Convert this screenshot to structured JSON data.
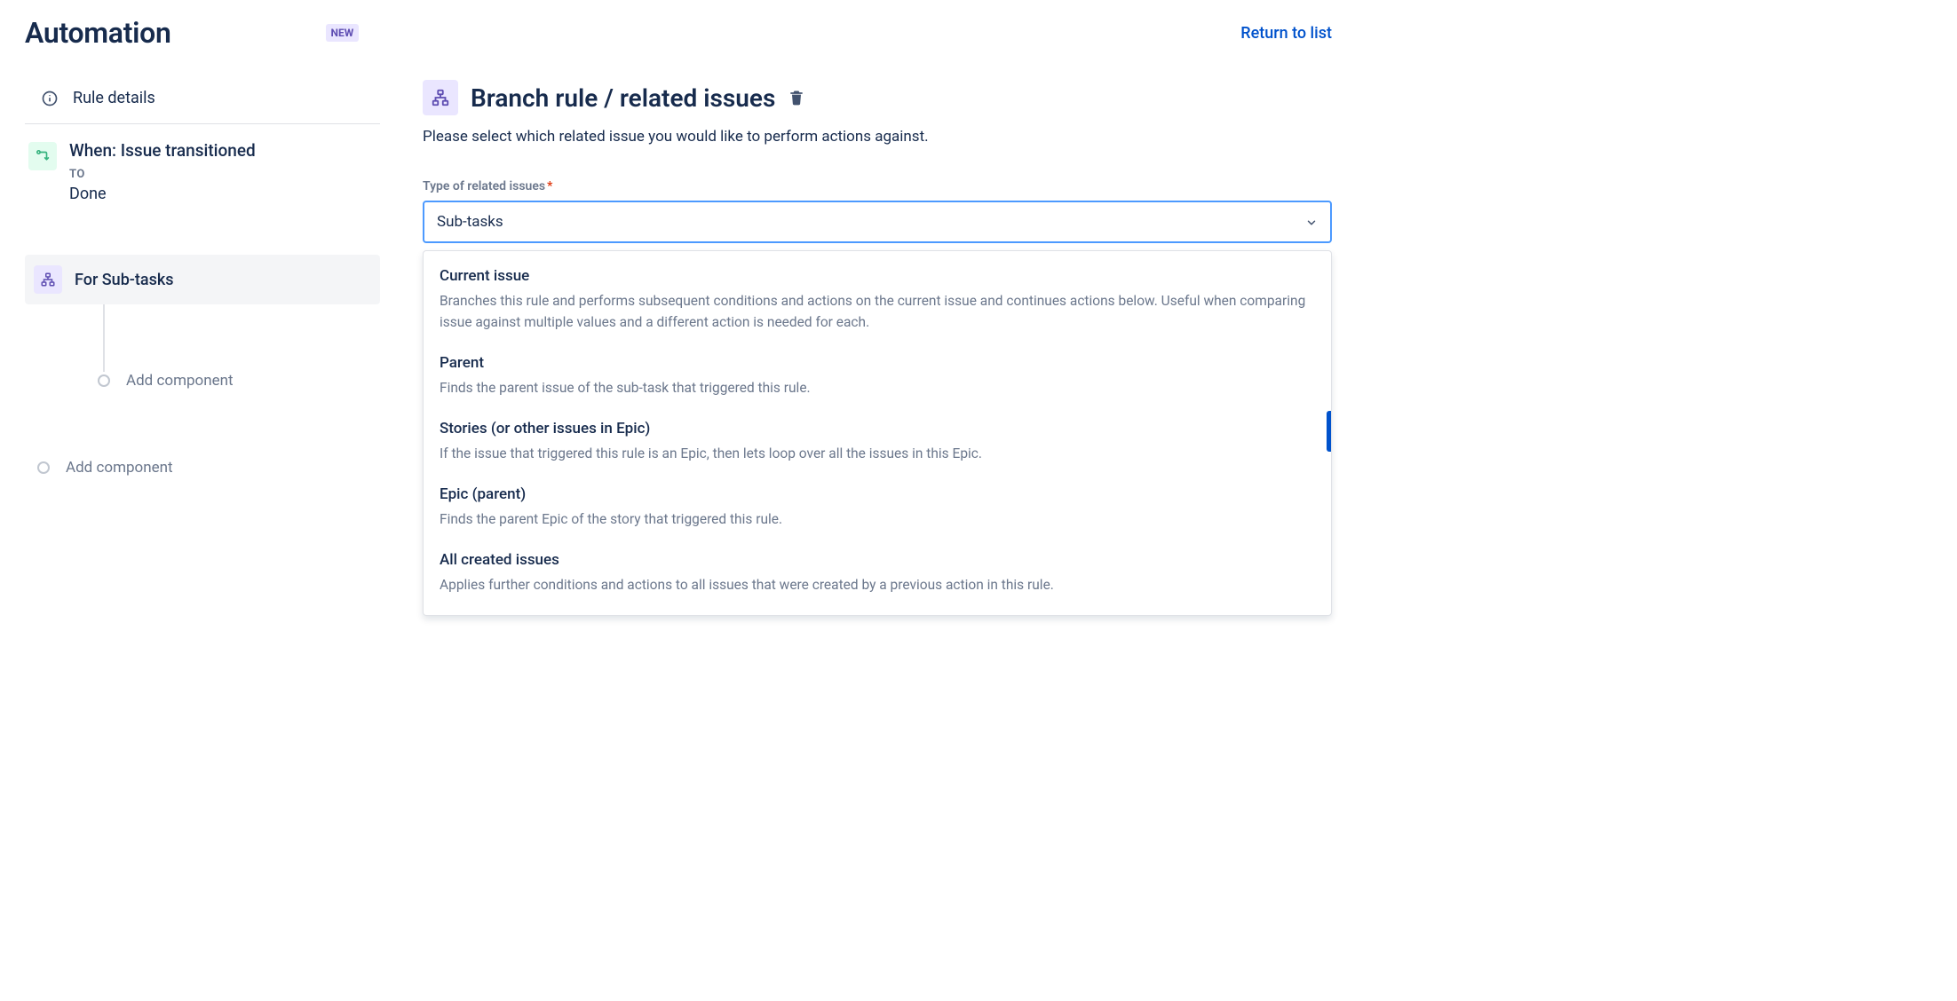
{
  "header": {
    "title": "Automation",
    "new_badge": "NEW",
    "return_link": "Return to list"
  },
  "sidebar": {
    "rule_details_label": "Rule details",
    "trigger": {
      "title": "When: Issue transitioned",
      "to_label": "TO",
      "to_value": "Done"
    },
    "branch": {
      "title": "For Sub-tasks"
    },
    "add_component_label": "Add component"
  },
  "panel": {
    "title": "Branch rule / related issues",
    "description": "Please select which related issue you would like to perform actions against."
  },
  "form": {
    "type_label": "Type of related issues",
    "selected_value": "Sub-tasks"
  },
  "options": [
    {
      "title": "Current issue",
      "desc": "Branches this rule and performs subsequent conditions and actions on the current issue and continues actions below. Useful when comparing issue against multiple values and a different action is needed for each."
    },
    {
      "title": "Parent",
      "desc": "Finds the parent issue of the sub-task that triggered this rule."
    },
    {
      "title": "Stories (or other issues in Epic)",
      "desc": "If the issue that triggered this rule is an Epic, then lets loop over all the issues in this Epic."
    },
    {
      "title": "Epic (parent)",
      "desc": "Finds the parent Epic of the story that triggered this rule."
    },
    {
      "title": "All created issues",
      "desc": "Applies further conditions and actions to all issues that were created by a previous action in this rule."
    }
  ]
}
